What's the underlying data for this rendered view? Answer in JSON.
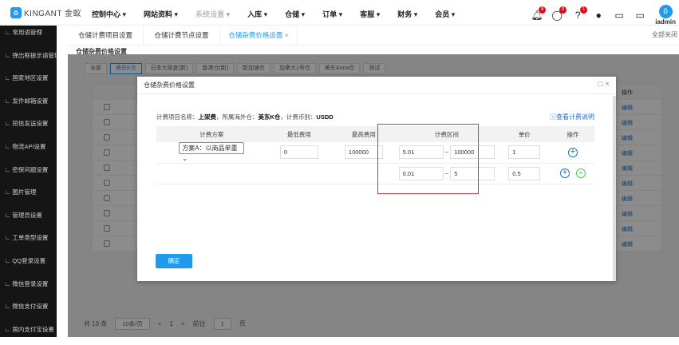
{
  "header": {
    "logo": "KINGANT 金蚁",
    "nav": [
      "控制中心 ▾",
      "网站资料 ▾",
      "系统设置 ▾",
      "入库 ▾",
      "仓储 ▾",
      "订单 ▾",
      "客服 ▾",
      "财务 ▾",
      "会员 ▾"
    ],
    "badges": {
      "bell": "8",
      "chat": "0",
      "help": "1"
    },
    "user": "iadmin"
  },
  "sidebar": {
    "items": [
      "常用语管理",
      "弹出框提示语管理",
      "国家地区设置",
      "发件邮箱设置",
      "短信发送设置",
      "物流API设置",
      "密保问题设置",
      "图片管理",
      "管理员设置",
      "工单类型设置",
      "QQ登录设置",
      "微信登录设置",
      "微信支付设置",
      "国内支付宝设置"
    ]
  },
  "tabs": [
    "仓储计费项目设置",
    "仓储计费节点设置",
    "仓储杂费价格设置"
  ],
  "close_all": "全部关闭",
  "page_title": "仓储杂费价格设置",
  "filters": [
    "全部",
    "美东K仓",
    "日本大阪倉(新)",
    "香港仓(新)",
    "新加坡仓",
    "加拿大1号仓",
    "美东Anna仓",
    "测试"
  ],
  "bg_table": {
    "op_header": "操作",
    "edit": "编辑",
    "rows": 10
  },
  "pager": {
    "total": "共 10 条",
    "per_page": "10条/页",
    "prev": "<",
    "page": "1",
    "next": ">",
    "goto": "前往",
    "goto_value": "1",
    "unit": "页"
  },
  "modal": {
    "title": "仓储杂费价格设置",
    "info_prefix": "计费项目名称：",
    "item": "上架费",
    "wh_prefix": "，所属海外仓：",
    "warehouse": "美东K仓",
    "cur_prefix": "，计费币别：",
    "currency": "USDD",
    "help": "查看计费说明",
    "columns": [
      "计费方案",
      "最低费用",
      "最高费用",
      "计费区间",
      "单价",
      "操作"
    ],
    "rows": [
      {
        "scheme": "方案A：以商品单重",
        "min": "0",
        "max": "100000",
        "from": "5.01",
        "to": "100000",
        "price": "1"
      },
      {
        "from": "0.01",
        "to": "5",
        "price": "0.5"
      }
    ],
    "confirm": "确定"
  }
}
